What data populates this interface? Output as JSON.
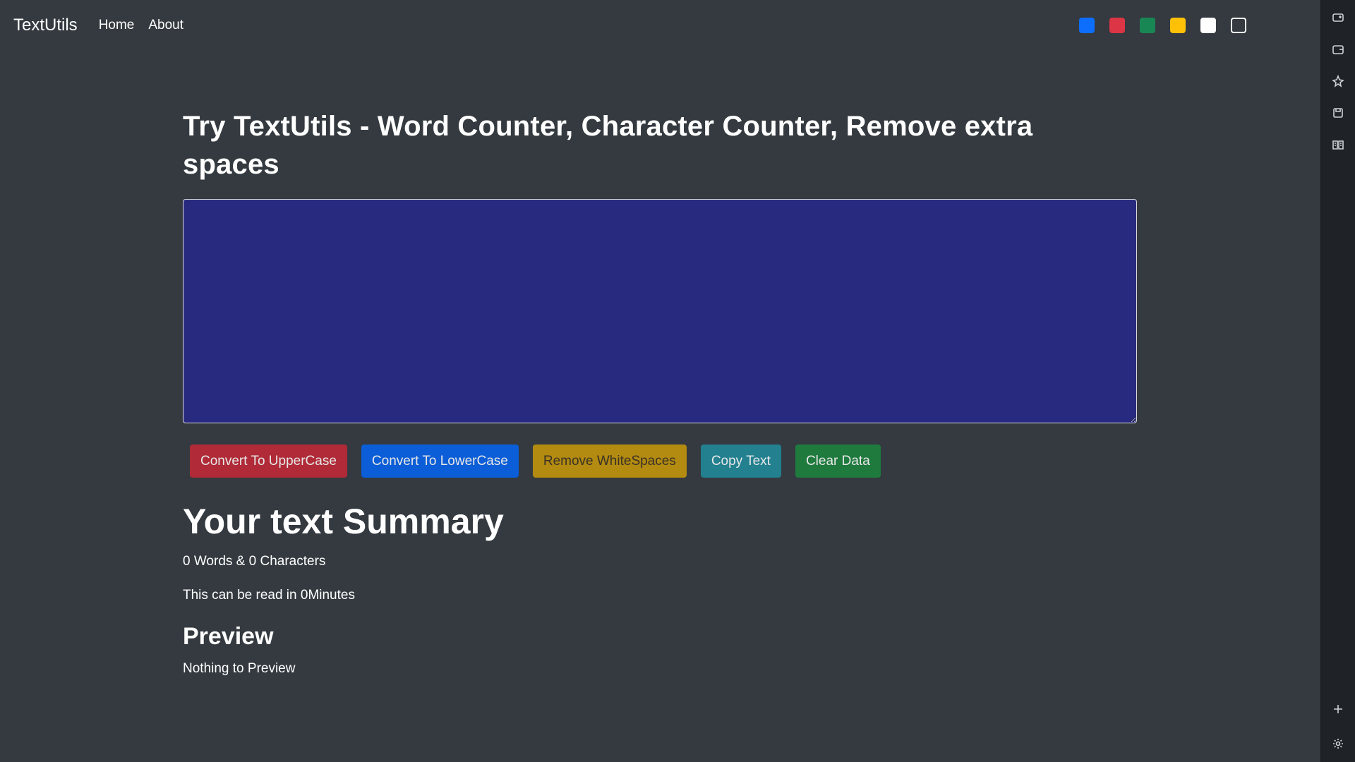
{
  "navbar": {
    "brand": "TextUtils",
    "links": [
      "Home",
      "About"
    ],
    "swatches": [
      "#0d6efd",
      "#dc3545",
      "#198754",
      "#ffc107",
      "#ffffff",
      "outline"
    ]
  },
  "main": {
    "title": "Try TextUtils - Word Counter, Character Counter, Remove extra spaces",
    "textarea_value": "",
    "buttons": {
      "upper": "Convert To UpperCase",
      "lower": "Convert To LowerCase",
      "whitespace": "Remove WhiteSpaces",
      "copy": "Copy Text",
      "clear": "Clear Data"
    },
    "summary": {
      "heading": "Your text Summary",
      "counts": "0 Words & 0 Characters",
      "read_time": "This can be read in 0Minutes"
    },
    "preview": {
      "heading": "Preview",
      "text": "Nothing to Preview"
    }
  },
  "colors": {
    "background": "#343a40",
    "textarea_bg": "#272a7e"
  },
  "side_panel": {
    "icons": [
      "screen-capture-icon",
      "wallet-icon",
      "sparkle-star-icon",
      "save-icon",
      "reader-icon",
      "add-icon",
      "settings-icon"
    ]
  }
}
